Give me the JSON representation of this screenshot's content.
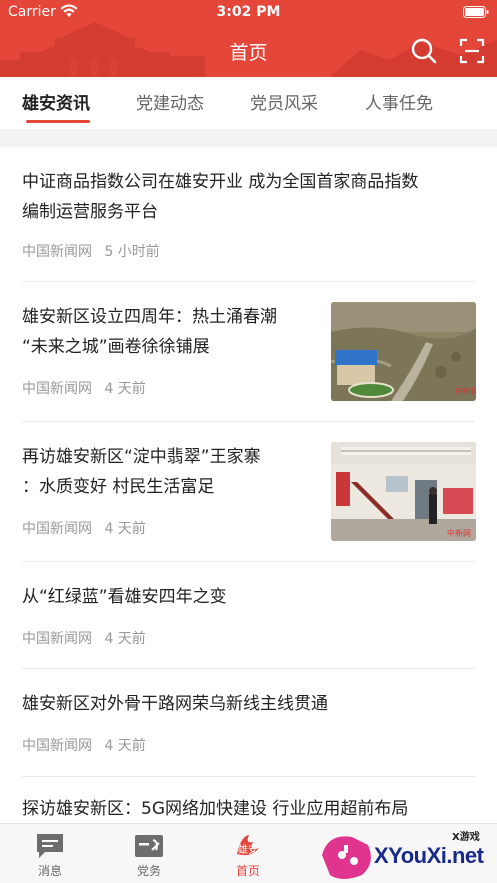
{
  "status_bar": {
    "carrier": "Carrier",
    "time": "3:02 PM"
  },
  "nav": {
    "title": "首页"
  },
  "tabs": [
    {
      "label": "雄安资讯",
      "active": true
    },
    {
      "label": "党建动态"
    },
    {
      "label": "党员风采"
    },
    {
      "label": "人事任免"
    }
  ],
  "news": [
    {
      "title_line1": "中证商品指数公司在雄安开业 成为全国首家商品指数",
      "title_line2": "编制运营服务平台",
      "source": "中国新闻网",
      "time": "5 小时前"
    },
    {
      "title_line1": "雄安新区设立四周年：热土涌春潮",
      "title_line2": "“未来之城”画卷徐徐铺展",
      "source": "中国新闻网",
      "time": "4 天前",
      "thumb_caption": "中新网"
    },
    {
      "title_line1": "再访雄安新区“淀中翡翠”王家寨",
      "title_line2": "：水质变好 村民生活富足",
      "source": "中国新闻网",
      "time": "4 天前",
      "thumb_caption": "中新网"
    },
    {
      "title_line1": "从“红绿蓝”看雄安四年之变",
      "source": "中国新闻网",
      "time": "4 天前"
    },
    {
      "title_line1": "雄安新区对外骨干路网荣乌新线主线贯通",
      "source": "中国新闻网",
      "time": "4 天前"
    },
    {
      "title_line1": "探访雄安新区：5G网络加快建设 行业应用超前布局"
    }
  ],
  "tabbar": [
    {
      "label": "消息"
    },
    {
      "label": "党务"
    },
    {
      "label": "首页",
      "active": true,
      "icon_text": "雄安"
    }
  ],
  "watermark": {
    "top": "X游戏",
    "text": "XYouXi.net"
  },
  "colors": {
    "brand": "#e5463a",
    "meta_text": "#999999"
  }
}
